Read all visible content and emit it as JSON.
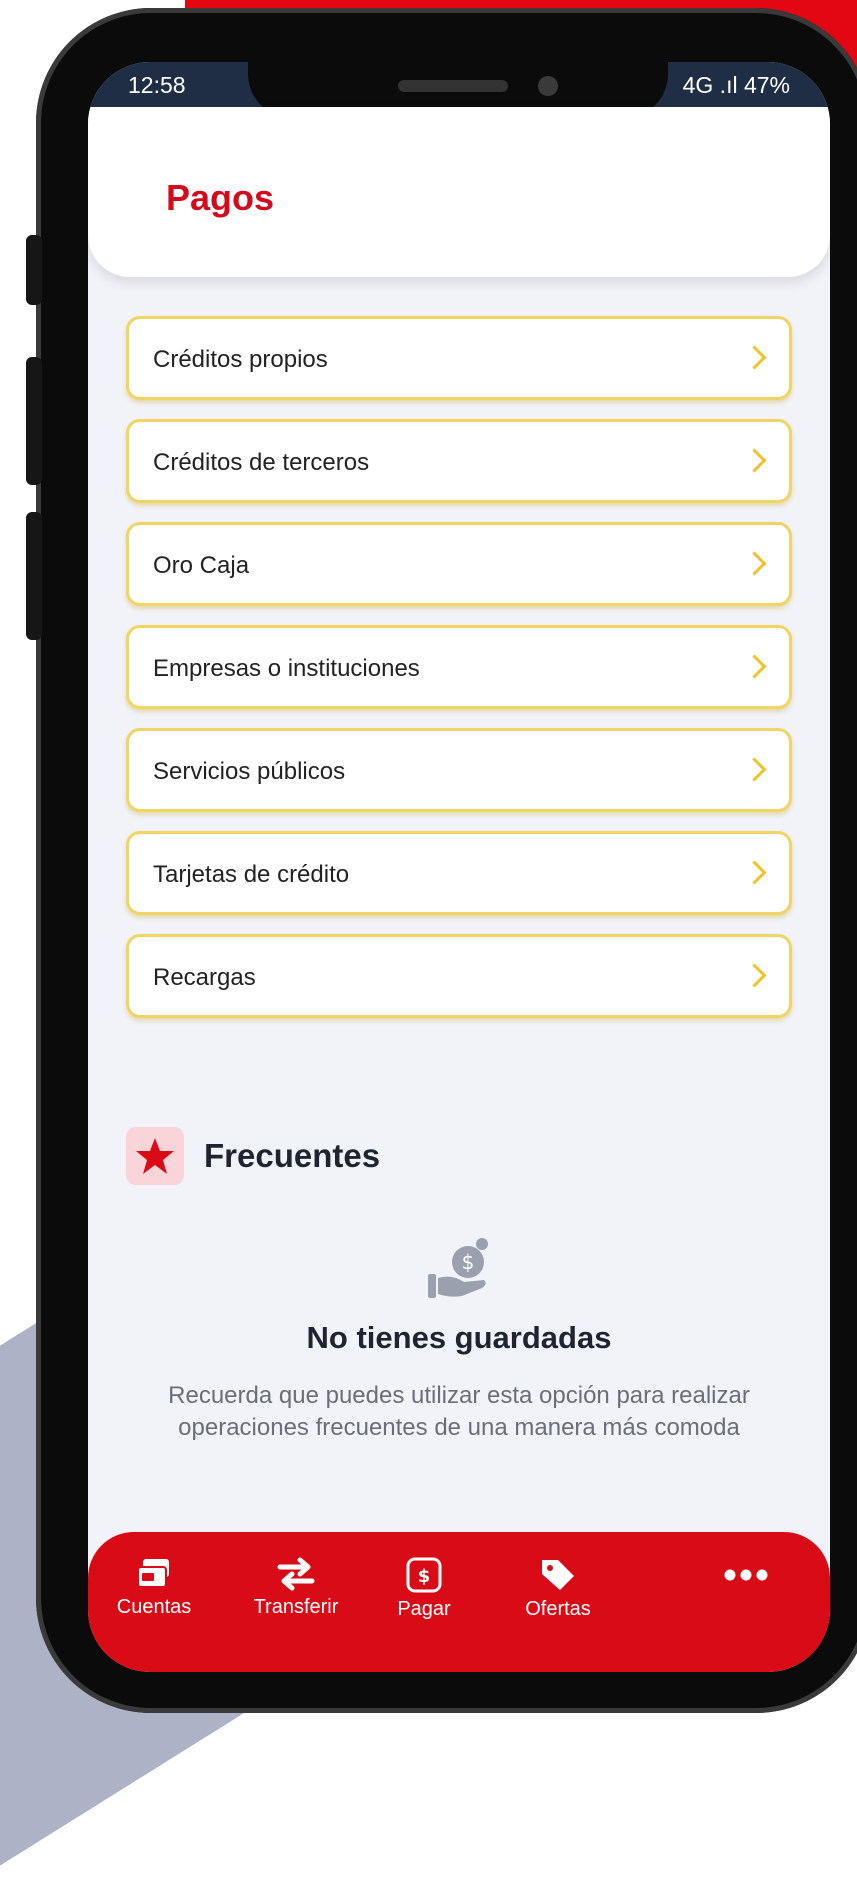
{
  "status_bar": {
    "time": "12:58",
    "right_text": "4G .ıl 47%"
  },
  "header": {
    "title": "Pagos"
  },
  "menu": {
    "items": [
      {
        "label": "Créditos propios"
      },
      {
        "label": "Créditos de terceros"
      },
      {
        "label": "Oro Caja"
      },
      {
        "label": "Empresas o instituciones"
      },
      {
        "label": "Servicios públicos"
      },
      {
        "label": "Tarjetas de crédito"
      },
      {
        "label": "Recargas"
      }
    ]
  },
  "frequent": {
    "title": "Frecuentes",
    "empty_title": "No tienes guardadas",
    "empty_description": "Recuerda que puedes utilizar esta opción para realizar operaciones frecuentes de una manera más comoda"
  },
  "bottom_nav": {
    "items": [
      {
        "label": "Cuentas",
        "icon": "cards-icon"
      },
      {
        "label": "Transferir",
        "icon": "transfer-arrows-icon"
      },
      {
        "label": "Pagar",
        "icon": "pay-icon"
      },
      {
        "label": "Ofertas",
        "icon": "tag-icon"
      },
      {
        "label": "",
        "icon": "more-dots-icon"
      }
    ]
  },
  "colors": {
    "brand_red": "#d80b17",
    "accent_yellow": "#f0d565",
    "background": "#f2f3f9"
  }
}
